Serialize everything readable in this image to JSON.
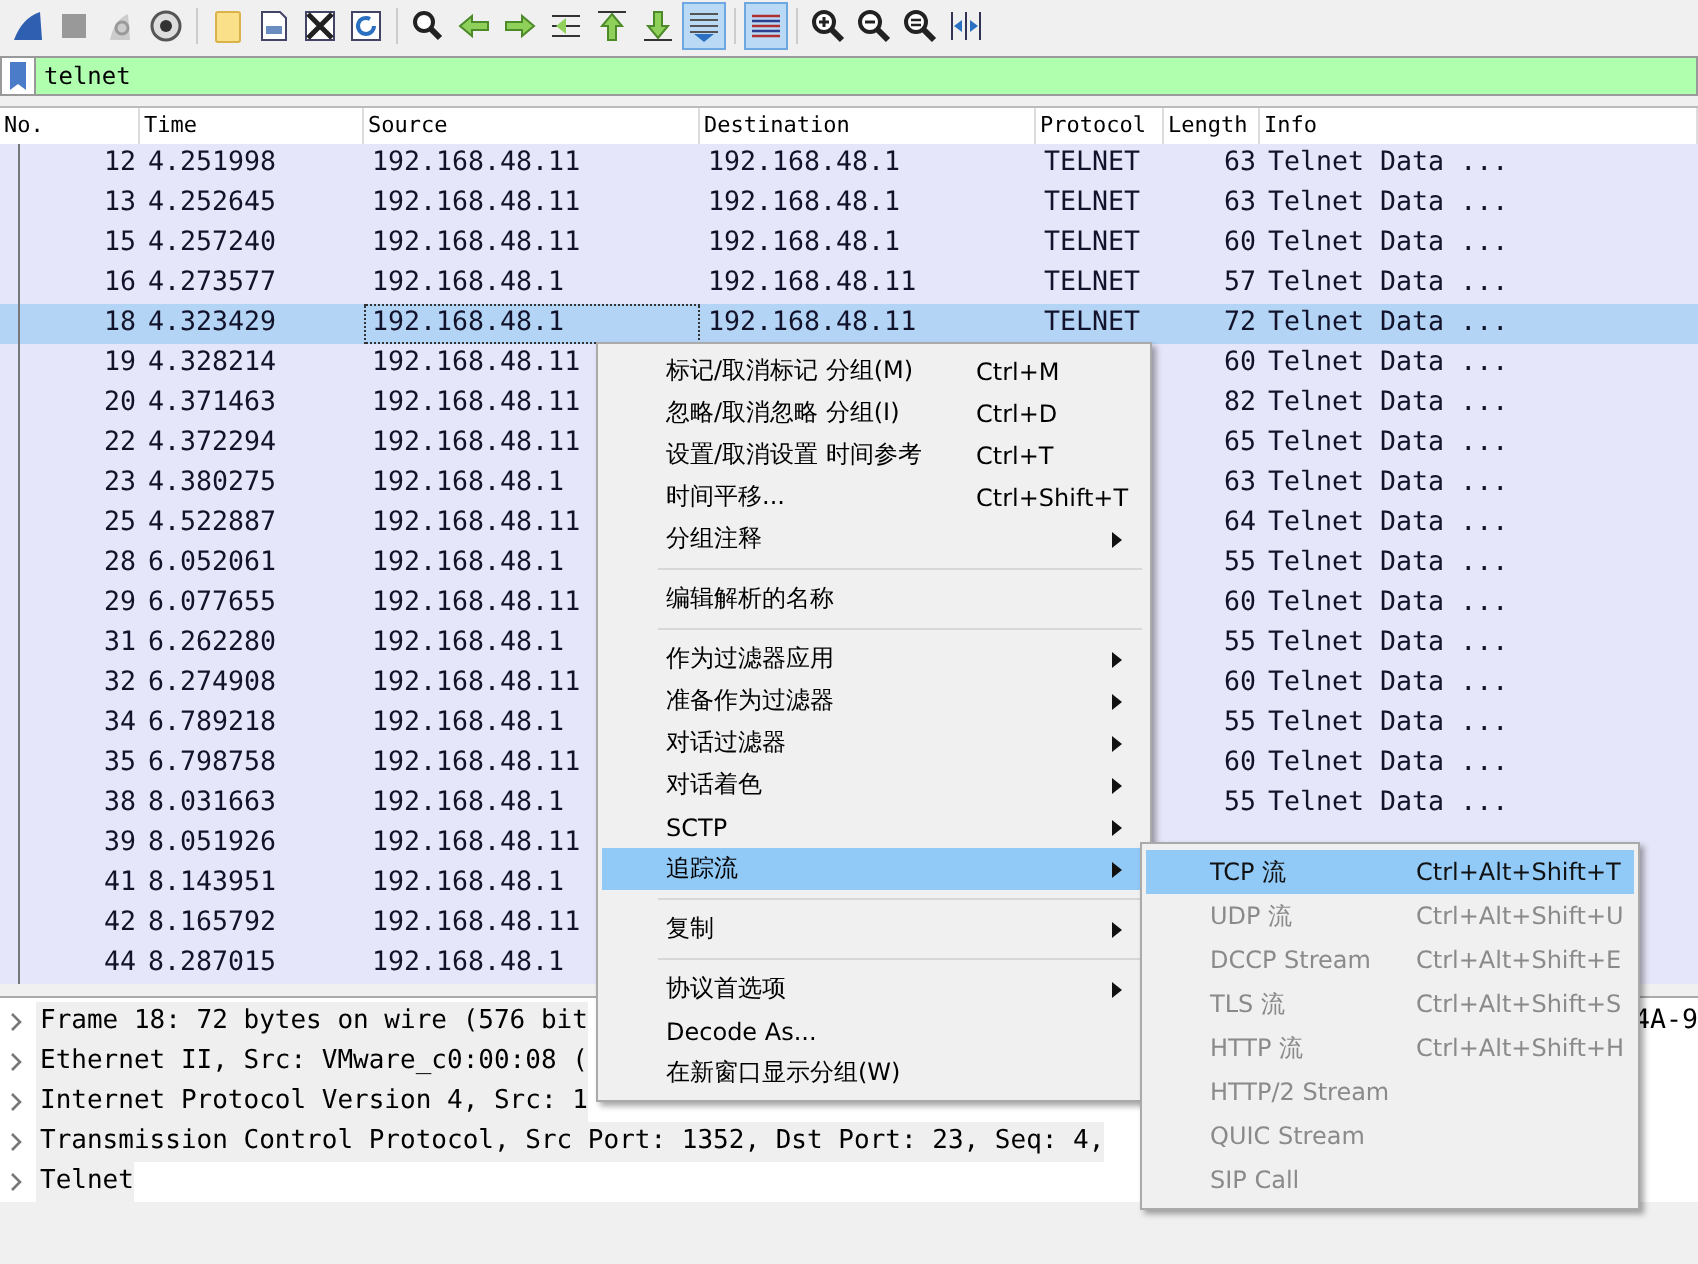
{
  "toolbar": [
    {
      "kind": "fin",
      "on": false
    },
    {
      "kind": "stop",
      "on": false
    },
    {
      "kind": "restart",
      "on": false
    },
    {
      "kind": "options",
      "on": false
    },
    {
      "kind": "sep"
    },
    {
      "kind": "open",
      "on": false
    },
    {
      "kind": "save",
      "on": false
    },
    {
      "kind": "close",
      "on": false
    },
    {
      "kind": "reload",
      "on": false
    },
    {
      "kind": "sep"
    },
    {
      "kind": "find",
      "on": false
    },
    {
      "kind": "back",
      "on": false
    },
    {
      "kind": "forward",
      "on": false
    },
    {
      "kind": "goto",
      "on": false
    },
    {
      "kind": "first",
      "on": false
    },
    {
      "kind": "last",
      "on": false
    },
    {
      "kind": "autoscroll",
      "on": true
    },
    {
      "kind": "sep"
    },
    {
      "kind": "colorize",
      "on": true
    },
    {
      "kind": "sep"
    },
    {
      "kind": "zoomin",
      "on": false
    },
    {
      "kind": "zoomout",
      "on": false
    },
    {
      "kind": "zoomreset",
      "on": false
    },
    {
      "kind": "resize",
      "on": false
    }
  ],
  "filter": {
    "value": "telnet"
  },
  "table": {
    "columns": [
      "No.",
      "Time",
      "Source",
      "Destination",
      "Protocol",
      "Length",
      "Info"
    ],
    "rows": [
      {
        "no": "12",
        "time": "4.251998",
        "source": "192.168.48.11",
        "destination": "192.168.48.1",
        "protocol": "TELNET",
        "length": "63",
        "info": "Telnet Data ...",
        "selected": false
      },
      {
        "no": "13",
        "time": "4.252645",
        "source": "192.168.48.11",
        "destination": "192.168.48.1",
        "protocol": "TELNET",
        "length": "63",
        "info": "Telnet Data ...",
        "selected": false
      },
      {
        "no": "15",
        "time": "4.257240",
        "source": "192.168.48.11",
        "destination": "192.168.48.1",
        "protocol": "TELNET",
        "length": "60",
        "info": "Telnet Data ...",
        "selected": false
      },
      {
        "no": "16",
        "time": "4.273577",
        "source": "192.168.48.1",
        "destination": "192.168.48.11",
        "protocol": "TELNET",
        "length": "57",
        "info": "Telnet Data ...",
        "selected": false
      },
      {
        "no": "18",
        "time": "4.323429",
        "source": "192.168.48.1",
        "destination": "192.168.48.11",
        "protocol": "TELNET",
        "length": "72",
        "info": "Telnet Data ...",
        "selected": true
      },
      {
        "no": "19",
        "time": "4.328214",
        "source": "192.168.48.11",
        "length": "60",
        "info": "Telnet Data ...",
        "selected": false
      },
      {
        "no": "20",
        "time": "4.371463",
        "source": "192.168.48.11",
        "length": "82",
        "info": "Telnet Data ...",
        "selected": false
      },
      {
        "no": "22",
        "time": "4.372294",
        "source": "192.168.48.11",
        "length": "65",
        "info": "Telnet Data ...",
        "selected": false
      },
      {
        "no": "23",
        "time": "4.380275",
        "source": "192.168.48.1",
        "length": "63",
        "info": "Telnet Data ...",
        "selected": false
      },
      {
        "no": "25",
        "time": "4.522887",
        "source": "192.168.48.11",
        "length": "64",
        "info": "Telnet Data ...",
        "selected": false
      },
      {
        "no": "28",
        "time": "6.052061",
        "source": "192.168.48.1",
        "length": "55",
        "info": "Telnet Data ...",
        "selected": false
      },
      {
        "no": "29",
        "time": "6.077655",
        "source": "192.168.48.11",
        "length": "60",
        "info": "Telnet Data ...",
        "selected": false
      },
      {
        "no": "31",
        "time": "6.262280",
        "source": "192.168.48.1",
        "length": "55",
        "info": "Telnet Data ...",
        "selected": false
      },
      {
        "no": "32",
        "time": "6.274908",
        "source": "192.168.48.11",
        "length": "60",
        "info": "Telnet Data ...",
        "selected": false
      },
      {
        "no": "34",
        "time": "6.789218",
        "source": "192.168.48.1",
        "length": "55",
        "info": "Telnet Data ...",
        "selected": false
      },
      {
        "no": "35",
        "time": "6.798758",
        "source": "192.168.48.11",
        "length": "60",
        "info": "Telnet Data ...",
        "selected": false
      },
      {
        "no": "38",
        "time": "8.031663",
        "source": "192.168.48.1",
        "length": "55",
        "info": "Telnet Data ...",
        "selected": false
      },
      {
        "no": "39",
        "time": "8.051926",
        "source": "192.168.48.11",
        "selected": false
      },
      {
        "no": "41",
        "time": "8.143951",
        "source": "192.168.48.1",
        "selected": false
      },
      {
        "no": "42",
        "time": "8.165792",
        "source": "192.168.48.11",
        "selected": false
      },
      {
        "no": "44",
        "time": "8.287015",
        "source": "192.168.48.1",
        "selected": false
      }
    ]
  },
  "details": [
    {
      "text": "Frame 18: 72 bytes on wire (576 bit",
      "tail": "4A-9"
    },
    {
      "text": "Ethernet II, Src: VMware_c0:00:08 ("
    },
    {
      "text": "Internet Protocol Version 4, Src: 1"
    },
    {
      "text": "Transmission Control Protocol, Src Port: 1352, Dst Port: 23, Seq: 4,"
    },
    {
      "text": "Telnet"
    }
  ],
  "context_menu": {
    "items": [
      {
        "kind": "item",
        "label": "标记/取消标记 分组(M)",
        "shortcut": "Ctrl+M",
        "submenu": false,
        "selected": false
      },
      {
        "kind": "item",
        "label": "忽略/取消忽略 分组(I)",
        "shortcut": "Ctrl+D",
        "submenu": false,
        "selected": false
      },
      {
        "kind": "item",
        "label": "设置/取消设置 时间参考",
        "shortcut": "Ctrl+T",
        "submenu": false,
        "selected": false
      },
      {
        "kind": "item",
        "label": "时间平移...",
        "shortcut": "Ctrl+Shift+T",
        "submenu": false,
        "selected": false
      },
      {
        "kind": "item",
        "label": "分组注释",
        "submenu": true,
        "selected": false
      },
      {
        "kind": "separator"
      },
      {
        "kind": "item",
        "label": "编辑解析的名称",
        "submenu": false,
        "selected": false
      },
      {
        "kind": "separator"
      },
      {
        "kind": "item",
        "label": "作为过滤器应用",
        "submenu": true,
        "selected": false
      },
      {
        "kind": "item",
        "label": "准备作为过滤器",
        "submenu": true,
        "selected": false
      },
      {
        "kind": "item",
        "label": "对话过滤器",
        "submenu": true,
        "selected": false
      },
      {
        "kind": "item",
        "label": "对话着色",
        "submenu": true,
        "selected": false
      },
      {
        "kind": "item",
        "label": "SCTP",
        "submenu": true,
        "selected": false
      },
      {
        "kind": "item",
        "label": "追踪流",
        "submenu": true,
        "selected": true
      },
      {
        "kind": "separator"
      },
      {
        "kind": "item",
        "label": "复制",
        "submenu": true,
        "selected": false
      },
      {
        "kind": "separator"
      },
      {
        "kind": "item",
        "label": "协议首选项",
        "submenu": true,
        "selected": false
      },
      {
        "kind": "item",
        "label": "Decode As...",
        "submenu": false,
        "selected": false
      },
      {
        "kind": "item",
        "label": "在新窗口显示分组(W)",
        "submenu": false,
        "selected": false
      }
    ]
  },
  "submenu": {
    "items": [
      {
        "label": "TCP 流",
        "shortcut": "Ctrl+Alt+Shift+T",
        "disabled": false,
        "selected": true
      },
      {
        "label": "UDP 流",
        "shortcut": "Ctrl+Alt+Shift+U",
        "disabled": true,
        "selected": false
      },
      {
        "label": "DCCP Stream",
        "shortcut": "Ctrl+Alt+Shift+E",
        "disabled": true,
        "selected": false
      },
      {
        "label": "TLS 流",
        "shortcut": "Ctrl+Alt+Shift+S",
        "disabled": true,
        "selected": false
      },
      {
        "label": "HTTP 流",
        "shortcut": "Ctrl+Alt+Shift+H",
        "disabled": true,
        "selected": false
      },
      {
        "label": "HTTP/2 Stream",
        "disabled": true,
        "selected": false
      },
      {
        "label": "QUIC Stream",
        "disabled": true,
        "selected": false
      },
      {
        "label": "SIP Call",
        "disabled": true,
        "selected": false
      }
    ]
  }
}
